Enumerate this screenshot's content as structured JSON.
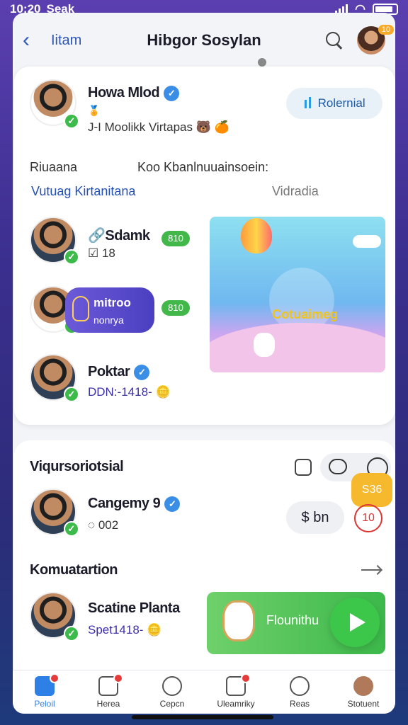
{
  "status": {
    "time": "10:20",
    "carrier": "Seak"
  },
  "header": {
    "back_label": "Iitam",
    "title": "Hibgor Sosylan",
    "avatar_badge": "10"
  },
  "profile": {
    "name": "Howa Mlod",
    "subtitle": "J-I Moolikk Virtapas",
    "portal_label": "Rolernial"
  },
  "section1": {
    "label_left": "Riuaana",
    "label_center": "Koo Kbanlnuuainsoein:",
    "link_left": "Vutuag Kirtanitana",
    "muted_right": "Vidradia"
  },
  "people": [
    {
      "name": "Sdamk",
      "meta": "18",
      "chip": "810"
    },
    {
      "name": "mitroo",
      "meta": "nonrya",
      "chip": "810"
    },
    {
      "name": "Poktar",
      "meta": "DDN:-1418-"
    }
  ],
  "illustration": {
    "caption": "Cotuaimeg"
  },
  "section2": {
    "title": "Viqursoriotsial",
    "badge": "S36",
    "person": {
      "name": "Cangemy 9",
      "meta": "002"
    },
    "pay_label": "$ bn",
    "timer": "10",
    "title2": "Komuatartion",
    "person2": {
      "name": "Scatine Planta",
      "meta": "Spet1418-"
    },
    "card_label": "Flounithu"
  },
  "tabs": [
    {
      "label": "Peloil",
      "badge": true
    },
    {
      "label": "Herea",
      "badge": true
    },
    {
      "label": "Cepcn",
      "badge": false
    },
    {
      "label": "Uleamriky",
      "badge": true
    },
    {
      "label": "Reas",
      "badge": false
    },
    {
      "label": "Stotuent",
      "badge": false
    }
  ],
  "colors": {
    "accent": "#2f80e6",
    "green": "#3dbb4a",
    "badge": "#f6b92e"
  }
}
